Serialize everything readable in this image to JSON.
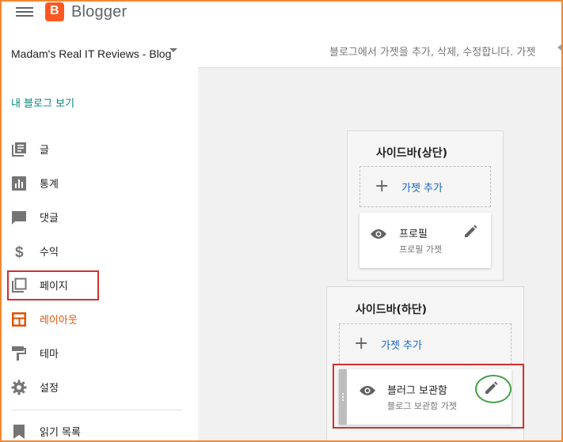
{
  "app": {
    "brand": "Blogger",
    "logo_letter": "B"
  },
  "sidebar": {
    "blog_name": "Madam's Real IT Reviews - Blog",
    "view_blog": "내 블로그 보기",
    "items": [
      {
        "label": "글",
        "icon": "posts-icon"
      },
      {
        "label": "통계",
        "icon": "stats-icon"
      },
      {
        "label": "댓글",
        "icon": "comments-icon"
      },
      {
        "label": "수익",
        "icon": "earnings-icon"
      },
      {
        "label": "페이지",
        "icon": "pages-icon"
      },
      {
        "label": "레이아웃",
        "icon": "layout-icon",
        "active": true
      },
      {
        "label": "테마",
        "icon": "theme-icon"
      },
      {
        "label": "설정",
        "icon": "settings-icon"
      },
      {
        "label": "읽기 목록",
        "icon": "reading-list-icon"
      }
    ]
  },
  "header": {
    "description": "블로그에서 가젯을 추가, 삭제, 수정합니다. 가젯"
  },
  "layout": {
    "sections": [
      {
        "title": "사이드바(상단)",
        "add_label": "가젯 추가",
        "gadgets": [
          {
            "title": "프로필",
            "subtitle": "프로필 가젯"
          }
        ]
      },
      {
        "title": "사이드바(하단)",
        "add_label": "가젯 추가",
        "gadgets": [
          {
            "title": "블러그 보관함",
            "subtitle": "블로그 보관함 가젯"
          }
        ]
      }
    ]
  },
  "colors": {
    "accent_orange": "#e65100",
    "link_teal": "#00897b",
    "link_blue": "#1565c0",
    "highlight_red": "#d32f2f",
    "highlight_green": "#43a047",
    "frame_orange": "#f0882f"
  }
}
